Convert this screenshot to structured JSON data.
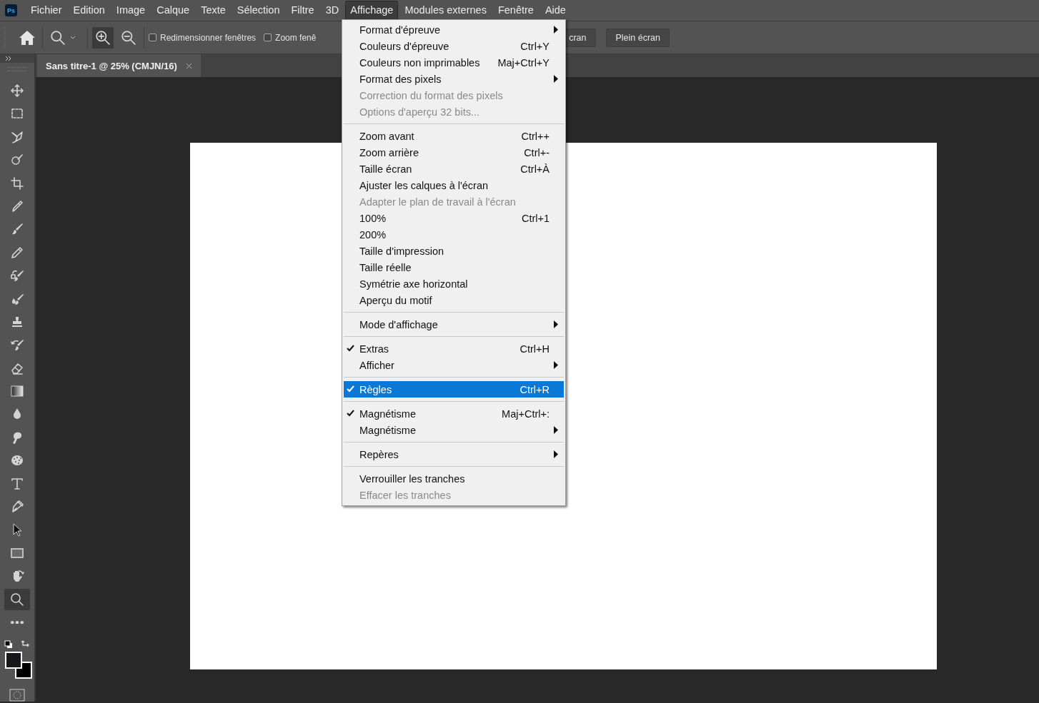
{
  "app_logo": "Ps",
  "menubar": [
    {
      "label": "Fichier",
      "selected": false
    },
    {
      "label": "Edition",
      "selected": false
    },
    {
      "label": "Image",
      "selected": false
    },
    {
      "label": "Calque",
      "selected": false
    },
    {
      "label": "Texte",
      "selected": false
    },
    {
      "label": "Sélection",
      "selected": false
    },
    {
      "label": "Filtre",
      "selected": false
    },
    {
      "label": "3D",
      "selected": false
    },
    {
      "label": "Affichage",
      "selected": true
    },
    {
      "label": "Modules externes",
      "selected": false
    },
    {
      "label": "Fenêtre",
      "selected": false
    },
    {
      "label": "Aide",
      "selected": false
    }
  ],
  "options_bar": {
    "zoom_modes": [
      {
        "kind": "zoom-in",
        "selected": true
      },
      {
        "kind": "zoom-out",
        "selected": false
      }
    ],
    "checkboxes": [
      {
        "label": "Redimensionner fenêtres",
        "checked": false
      },
      {
        "label": "Zoom fenê",
        "checked": false
      }
    ],
    "buttons": [
      "cran",
      "Plein écran"
    ]
  },
  "document_tab": {
    "title": "Sans titre-1 @ 25% (CMJN/16)"
  },
  "tools": [
    {
      "selected": false
    },
    {
      "selected": false
    },
    {
      "selected": false
    },
    {
      "selected": false
    },
    {
      "selected": false
    },
    {
      "selected": false
    },
    {
      "selected": false
    },
    {
      "selected": false
    },
    {
      "selected": false
    },
    {
      "selected": false
    },
    {
      "selected": false
    },
    {
      "selected": false
    },
    {
      "selected": false
    },
    {
      "selected": false
    },
    {
      "selected": false
    },
    {
      "selected": false
    },
    {
      "selected": false
    },
    {
      "selected": false
    },
    {
      "selected": false
    },
    {
      "selected": false
    },
    {
      "selected": false
    },
    {
      "selected": false
    },
    {
      "selected": true
    },
    {
      "selected": false
    }
  ],
  "menu": [
    {
      "kind": "item",
      "label": "Format d'épreuve",
      "submenu": true,
      "checked": false,
      "disabled": false,
      "selected": false
    },
    {
      "kind": "item",
      "label": "Couleurs d'épreuve",
      "shortcut": "Ctrl+Y",
      "submenu": false,
      "checked": false,
      "disabled": false,
      "selected": false
    },
    {
      "kind": "item",
      "label": "Couleurs non imprimables",
      "shortcut": "Maj+Ctrl+Y",
      "submenu": false,
      "checked": false,
      "disabled": false,
      "selected": false
    },
    {
      "kind": "item",
      "label": "Format des pixels",
      "submenu": true,
      "checked": false,
      "disabled": false,
      "selected": false
    },
    {
      "kind": "item",
      "label": "Correction du format des pixels",
      "submenu": false,
      "checked": false,
      "disabled": true,
      "selected": false
    },
    {
      "kind": "item",
      "label": "Options d'aperçu 32 bits...",
      "submenu": false,
      "checked": false,
      "disabled": true,
      "selected": false
    },
    {
      "kind": "separator"
    },
    {
      "kind": "item",
      "label": "Zoom avant",
      "shortcut": "Ctrl++",
      "submenu": false,
      "checked": false,
      "disabled": false,
      "selected": false
    },
    {
      "kind": "item",
      "label": "Zoom arrière",
      "shortcut": "Ctrl+-",
      "submenu": false,
      "checked": false,
      "disabled": false,
      "selected": false
    },
    {
      "kind": "item",
      "label": "Taille écran",
      "shortcut": "Ctrl+À",
      "submenu": false,
      "checked": false,
      "disabled": false,
      "selected": false
    },
    {
      "kind": "item",
      "label": "Ajuster les calques à l'écran",
      "submenu": false,
      "checked": false,
      "disabled": false,
      "selected": false
    },
    {
      "kind": "item",
      "label": "Adapter le plan de travail à l'écran",
      "submenu": false,
      "checked": false,
      "disabled": true,
      "selected": false
    },
    {
      "kind": "item",
      "label": "100%",
      "shortcut": "Ctrl+1",
      "submenu": false,
      "checked": false,
      "disabled": false,
      "selected": false
    },
    {
      "kind": "item",
      "label": "200%",
      "submenu": false,
      "checked": false,
      "disabled": false,
      "selected": false
    },
    {
      "kind": "item",
      "label": "Taille d'impression",
      "submenu": false,
      "checked": false,
      "disabled": false,
      "selected": false
    },
    {
      "kind": "item",
      "label": "Taille réelle",
      "submenu": false,
      "checked": false,
      "disabled": false,
      "selected": false
    },
    {
      "kind": "item",
      "label": "Symétrie axe horizontal",
      "submenu": false,
      "checked": false,
      "disabled": false,
      "selected": false
    },
    {
      "kind": "item",
      "label": "Aperçu du motif",
      "submenu": false,
      "checked": false,
      "disabled": false,
      "selected": false
    },
    {
      "kind": "separator"
    },
    {
      "kind": "item",
      "label": "Mode d'affichage",
      "submenu": true,
      "checked": false,
      "disabled": false,
      "selected": false
    },
    {
      "kind": "separator"
    },
    {
      "kind": "item",
      "label": "Extras",
      "shortcut": "Ctrl+H",
      "submenu": false,
      "checked": true,
      "disabled": false,
      "selected": false
    },
    {
      "kind": "item",
      "label": "Afficher",
      "submenu": true,
      "checked": false,
      "disabled": false,
      "selected": false
    },
    {
      "kind": "separator"
    },
    {
      "kind": "item",
      "label": "Règles",
      "shortcut": "Ctrl+R",
      "submenu": false,
      "checked": true,
      "disabled": false,
      "selected": true
    },
    {
      "kind": "separator"
    },
    {
      "kind": "item",
      "label": "Magnétisme",
      "shortcut": "Maj+Ctrl+:",
      "submenu": false,
      "checked": true,
      "disabled": false,
      "selected": false
    },
    {
      "kind": "item",
      "label": "Magnétisme",
      "submenu": true,
      "checked": false,
      "disabled": false,
      "selected": false
    },
    {
      "kind": "separator"
    },
    {
      "kind": "item",
      "label": "Repères",
      "submenu": true,
      "checked": false,
      "disabled": false,
      "selected": false
    },
    {
      "kind": "separator"
    },
    {
      "kind": "item",
      "label": "Verrouiller les tranches",
      "submenu": false,
      "checked": false,
      "disabled": false,
      "selected": false
    },
    {
      "kind": "item",
      "label": "Effacer les tranches",
      "submenu": false,
      "checked": false,
      "disabled": true,
      "selected": false
    }
  ]
}
